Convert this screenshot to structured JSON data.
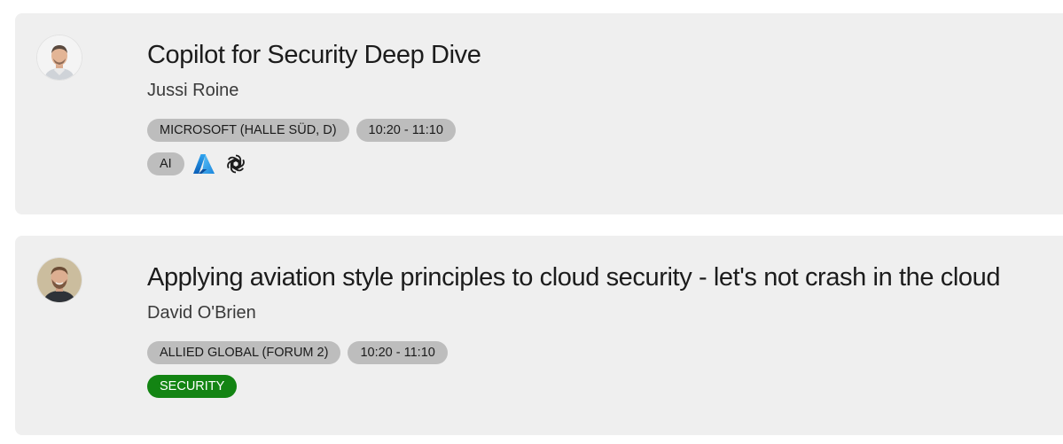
{
  "sessions": [
    {
      "title": "Copilot for Security Deep Dive",
      "speaker": "Jussi Roine",
      "room": "MICROSOFT (HALLE SÜD, D)",
      "time": "10:20 - 11:10",
      "topic": "AI",
      "topic_icons": [
        "azure-icon",
        "openai-icon"
      ],
      "topic_color": "#bdbdbd"
    },
    {
      "title": "Applying aviation style principles to cloud security - let's not crash in the cloud",
      "speaker": "David O'Brien",
      "room": "ALLIED GLOBAL (FORUM 2)",
      "time": "10:20 - 11:10",
      "topic": "SECURITY",
      "topic_color": "#138413"
    }
  ],
  "colors": {
    "card_bg": "#efefef",
    "tag_bg": "#bdbdbd",
    "security_green": "#138413",
    "azure_blue": "#0078d4"
  }
}
